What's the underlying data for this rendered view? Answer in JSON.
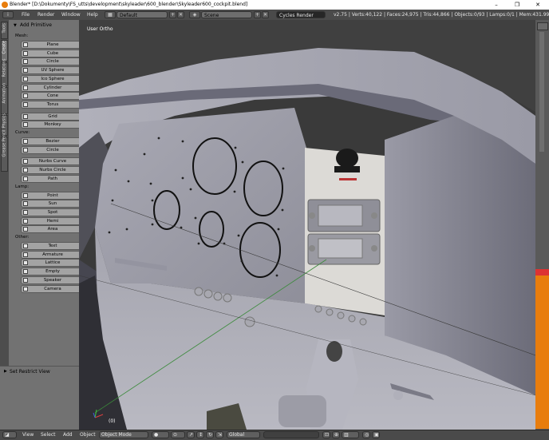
{
  "window": {
    "title": "Blender* [D:\\Dokumenty\\FS_utts\\development\\skyleader\\600_blender\\Skyleader600_cockpit.blend]",
    "minimize": "–",
    "maximize": "❐",
    "close": "✕"
  },
  "menubar": {
    "items": [
      "File",
      "Render",
      "Window",
      "Help"
    ],
    "screen_layout": "Default",
    "scene": "Scene",
    "render_engine": "Cycles Render",
    "stats": "v2.75 | Verts:40,122 | Faces:24,975 | Tris:44,866 | Objects:0/93 | Lamps:0/1 | Mem:431.99M"
  },
  "left_tabs": [
    "Tools",
    "Create",
    "Relations",
    "Animation",
    "Physics",
    "Grease Pencil"
  ],
  "tool_panel": {
    "header": "Add Primitive",
    "sections": [
      {
        "label": "Mesh:",
        "items": [
          "Plane",
          "Cube",
          "Circle",
          "UV Sphere",
          "Ico Sphere",
          "Cylinder",
          "Cone",
          "Torus"
        ]
      },
      {
        "label": "",
        "items": [
          "Grid",
          "Monkey"
        ]
      },
      {
        "label": "Curve:",
        "items": [
          "Bezier",
          "Circle"
        ]
      },
      {
        "label": "",
        "items": [
          "Nurbs Curve",
          "Nurbs Circle",
          "Path"
        ]
      },
      {
        "label": "Lamp:",
        "items": [
          "Point",
          "Sun",
          "Spot",
          "Hemi",
          "Area"
        ]
      },
      {
        "label": "Other:",
        "items": [
          "Text",
          "Armature",
          "Lattice",
          "Empty",
          "Speaker",
          "Camera"
        ]
      }
    ]
  },
  "restrict_panel": {
    "header": "Set Restrict View"
  },
  "viewport": {
    "label": "User Ortho",
    "frame": "(0)"
  },
  "statusbar": {
    "menus": [
      "View",
      "Select",
      "Add",
      "Object"
    ],
    "mode": "Object Mode",
    "orientation": "Global"
  },
  "colors": {
    "accent": "#e87d0d",
    "panel": "#727272",
    "button": "#a3a3a3",
    "header": "#4a4a4a"
  }
}
